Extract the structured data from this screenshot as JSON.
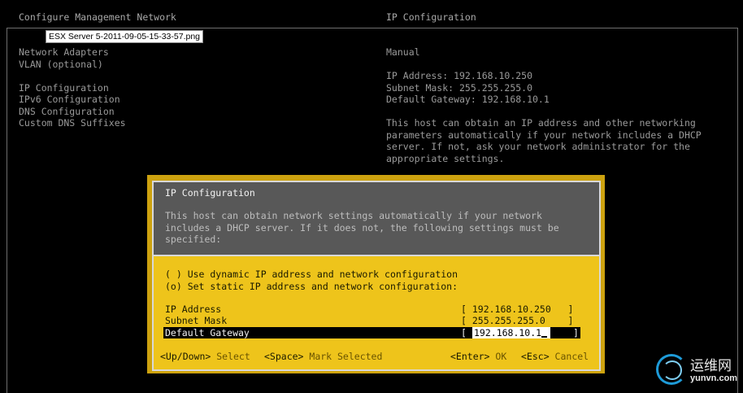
{
  "header": {
    "left_title": "Configure Management Network",
    "right_title": "IP Configuration"
  },
  "tooltip": "ESX Server 5-2011-09-05-15-33-57.png",
  "menu": {
    "items": [
      "Network Adapters",
      "VLAN (optional)",
      "",
      "IP Configuration",
      "IPv6 Configuration",
      "DNS Configuration",
      "Custom DNS Suffixes"
    ]
  },
  "info": {
    "mode": "Manual",
    "ip_line": "IP Address: 192.168.10.250",
    "mask_line": "Subnet Mask: 255.255.255.0",
    "gw_line": "Default Gateway: 192.168.10.1",
    "desc_lines": [
      "This host can obtain an IP address and other networking",
      "parameters automatically if your network includes a DHCP",
      "server. If not, ask your network administrator for the",
      "appropriate settings."
    ]
  },
  "dialog": {
    "title": "IP Configuration",
    "desc_lines": [
      "This host can obtain network settings automatically if your network",
      "includes a DHCP server. If it does not, the following settings must be",
      "specified:"
    ],
    "option_dhcp": "( ) Use dynamic IP address and network configuration",
    "option_static": "(o) Set static IP address and network configuration:",
    "fields": {
      "ip_label": "IP Address",
      "ip_value": "[ 192.168.10.250   ]",
      "mask_label": "Subnet Mask",
      "mask_value": "[ 255.255.255.0    ]",
      "gw_label": "Default Gateway",
      "gw_value": "192.168.10.1"
    },
    "footer": {
      "nav_key": "<Up/Down>",
      "nav_text": " Select",
      "space_key": "<Space>",
      "space_text": " Mark Selected",
      "enter_key": "<Enter>",
      "enter_text": " OK",
      "esc_key": "<Esc>",
      "esc_text": " Cancel"
    }
  },
  "watermark": {
    "cn": "运维网",
    "url": "yunvn.com"
  },
  "colors": {
    "background": "#000000",
    "dialog_yellow": "#eec41b",
    "dialog_grey": "#585858"
  }
}
